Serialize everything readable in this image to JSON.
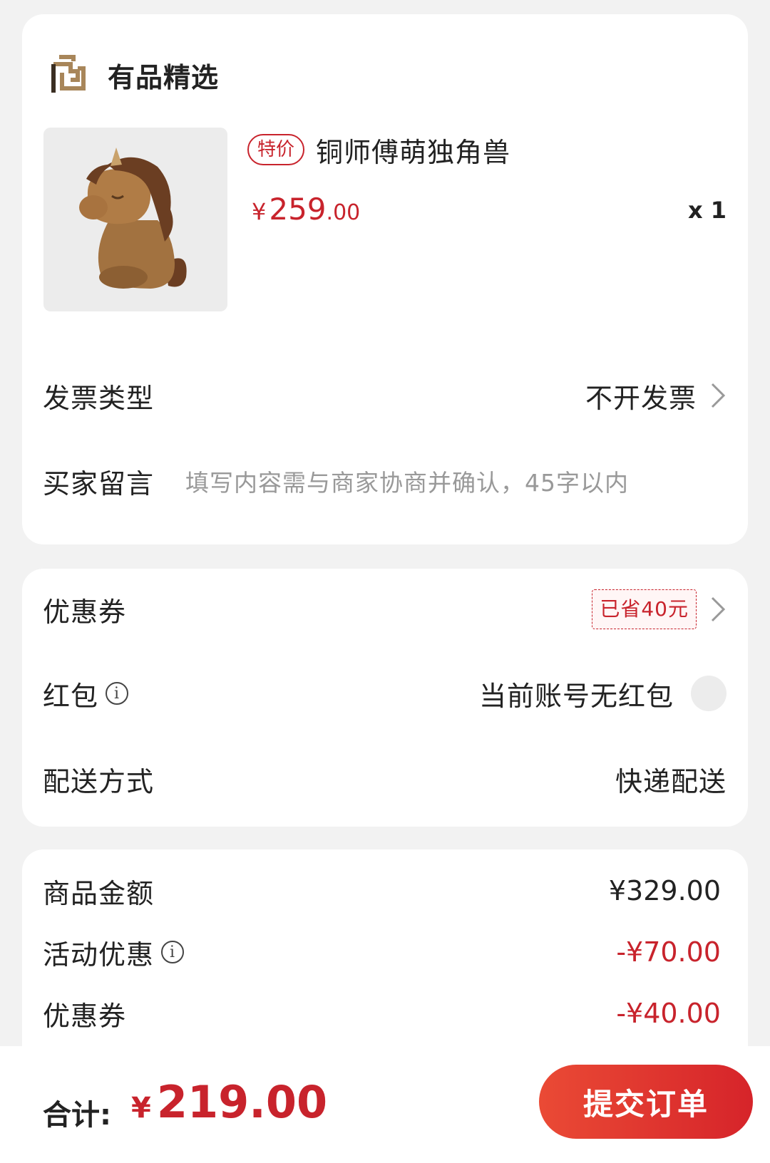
{
  "store": {
    "name": "有品精选",
    "logo_icon": "youpin-logo-icon"
  },
  "product": {
    "tag": "特价",
    "title": "铜师傅萌独角兽",
    "price_symbol": "¥",
    "price_int": "259",
    "price_dec": ".00",
    "quantity": "x 1"
  },
  "invoice": {
    "label": "发票类型",
    "value": "不开发票"
  },
  "message": {
    "label": "买家留言",
    "placeholder": "填写内容需与商家协商并确认，45字以内"
  },
  "coupon": {
    "label": "优惠券",
    "badge": "已省40元"
  },
  "red_packet": {
    "label": "红包",
    "value": "当前账号无红包"
  },
  "delivery": {
    "label": "配送方式",
    "value": "快递配送"
  },
  "summary": {
    "goods_label": "商品金额",
    "goods_amount": "¥329.00",
    "promo_label": "活动优惠",
    "promo_amount": "-¥70.00",
    "coupon_label": "优惠券",
    "coupon_amount": "-¥40.00"
  },
  "footer": {
    "total_label": "合计:",
    "total_symbol": "¥",
    "total_amount": "219.00",
    "submit_label": "提交订单"
  },
  "colors": {
    "accent": "#c8232c",
    "button": "#e23a30",
    "logo": "#a8865a"
  }
}
